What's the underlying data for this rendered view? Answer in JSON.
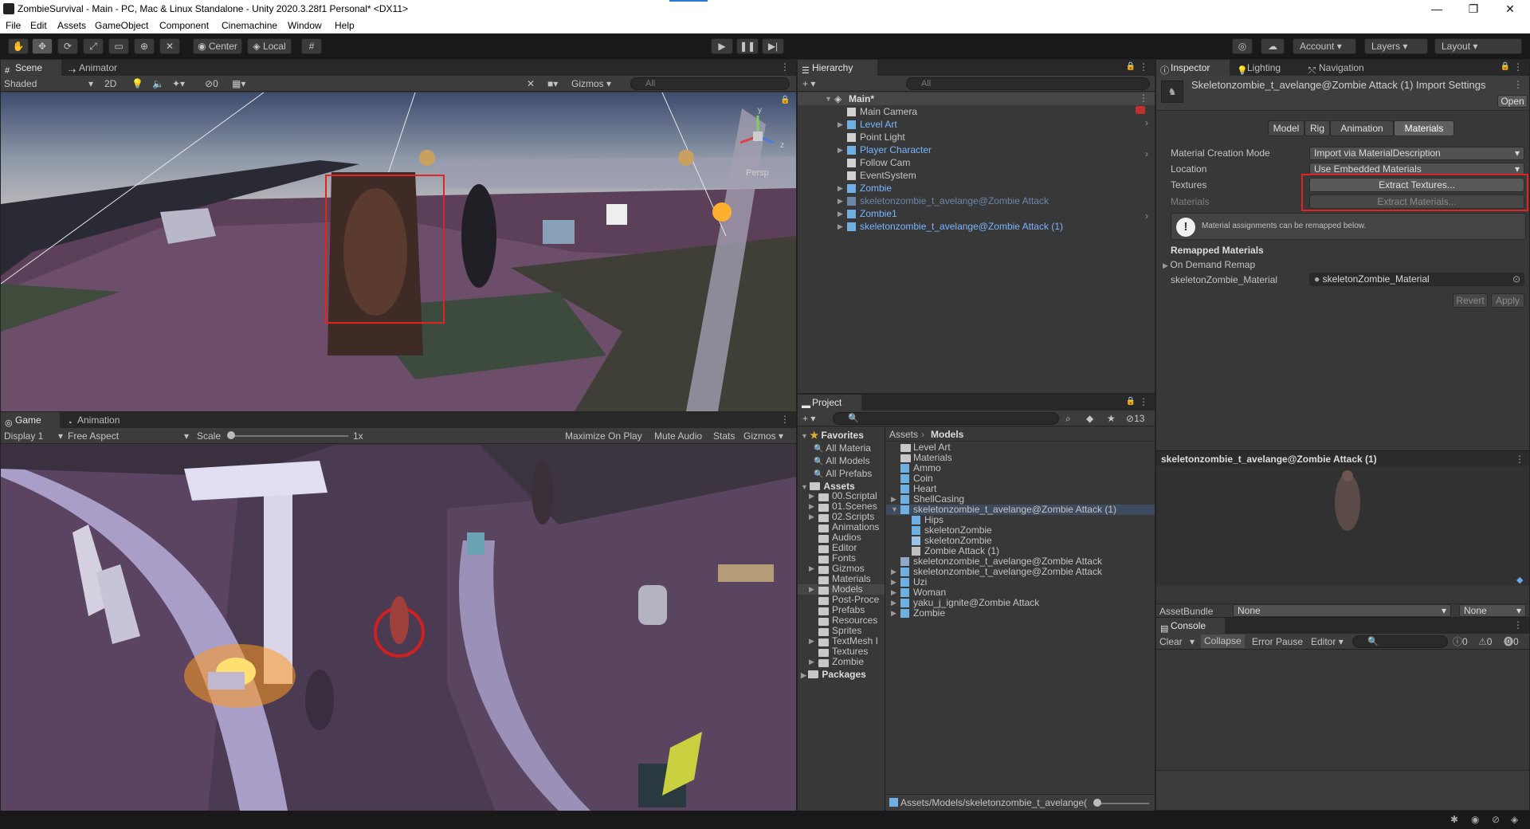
{
  "window": {
    "title": "ZombieSurvival - Main - PC, Mac & Linux Standalone - Unity 2020.3.28f1 Personal* <DX11>",
    "minimize": "—",
    "maximize": "❐",
    "close": "✕"
  },
  "menu": [
    "File",
    "Edit",
    "Assets",
    "GameObject",
    "Component",
    "Cinemachine",
    "Window",
    "Help"
  ],
  "toolbar": {
    "center": "Center",
    "local": "Local",
    "account": "Account",
    "layers": "Layers",
    "layout": "Layout"
  },
  "scene": {
    "tabs": [
      "Scene",
      "Animator"
    ],
    "shading": "Shaded",
    "mode2d": "2D",
    "hidden_count": "0",
    "gizmos": "Gizmos",
    "search_placeholder": "All",
    "persp_label": "Persp"
  },
  "game": {
    "tabs": [
      "Game",
      "Animation"
    ],
    "display": "Display 1",
    "aspect": "Free Aspect",
    "scale_label": "Scale",
    "scale_value": "1x",
    "maximize": "Maximize On Play",
    "mute": "Mute Audio",
    "stats": "Stats",
    "gizmos": "Gizmos"
  },
  "hierarchy": {
    "tab": "Hierarchy",
    "search_placeholder": "All",
    "scene_name": "Main*",
    "items": [
      {
        "label": "Main Camera",
        "style": "normal",
        "expand": false
      },
      {
        "label": "Level Art",
        "style": "blue",
        "expand": true
      },
      {
        "label": "Point Light",
        "style": "normal",
        "expand": false
      },
      {
        "label": "Player Character",
        "style": "blue",
        "expand": true
      },
      {
        "label": "Follow Cam",
        "style": "normal",
        "expand": false
      },
      {
        "label": "EventSystem",
        "style": "normal",
        "expand": false
      },
      {
        "label": "Zombie",
        "style": "blue",
        "expand": true
      },
      {
        "label": "skeletonzombie_t_avelange@Zombie Attack",
        "style": "dim",
        "expand": true
      },
      {
        "label": "Zombie1",
        "style": "blue",
        "expand": true
      },
      {
        "label": "skeletonzombie_t_avelange@Zombie Attack (1)",
        "style": "blue",
        "expand": true
      }
    ]
  },
  "project": {
    "tab": "Project",
    "count": "13",
    "favorites_label": "Favorites",
    "favorites": [
      "All Materia",
      "All Models",
      "All Prefabs"
    ],
    "assets_label": "Assets",
    "folders": [
      "00.Scriptal",
      "01.Scenes",
      "02.Scripts",
      "Animations",
      "Audios",
      "Editor",
      "Fonts",
      "Gizmos",
      "Materials",
      "Models",
      "Post-Proce",
      "Prefabs",
      "Resources",
      "Sprites",
      "TextMesh I",
      "Textures",
      "Zombie"
    ],
    "packages_label": "Packages",
    "breadcrumb_root": "Assets",
    "breadcrumb_current": "Models",
    "files": [
      {
        "label": "Level Art",
        "kind": "folder",
        "indent": 0
      },
      {
        "label": "Materials",
        "kind": "folder",
        "indent": 0
      },
      {
        "label": "Ammo",
        "kind": "model",
        "indent": 0
      },
      {
        "label": "Coin",
        "kind": "model",
        "indent": 0
      },
      {
        "label": "Heart",
        "kind": "model",
        "indent": 0
      },
      {
        "label": "ShellCasing",
        "kind": "model",
        "indent": 0
      },
      {
        "label": "skeletonzombie_t_avelange@Zombie Attack (1)",
        "kind": "model",
        "indent": 0,
        "selected": true
      },
      {
        "label": "Hips",
        "kind": "model",
        "indent": 1
      },
      {
        "label": "skeletonZombie",
        "kind": "model",
        "indent": 1
      },
      {
        "label": "skeletonZombie",
        "kind": "mesh",
        "indent": 1
      },
      {
        "label": "Zombie Attack (1)",
        "kind": "anim",
        "indent": 1
      },
      {
        "label": "skeletonzombie_t_avelange@Zombie Attack",
        "kind": "prefab",
        "indent": 0
      },
      {
        "label": "skeletonzombie_t_avelange@Zombie Attack",
        "kind": "model",
        "indent": 0
      },
      {
        "label": "Uzi",
        "kind": "model",
        "indent": 0
      },
      {
        "label": "Woman",
        "kind": "model",
        "indent": 0
      },
      {
        "label": "yaku_j_ignite@Zombie Attack",
        "kind": "model",
        "indent": 0
      },
      {
        "label": "Zombie",
        "kind": "model",
        "indent": 0
      }
    ],
    "path": "Assets/Models/skeletonzombie_t_avelange("
  },
  "inspector": {
    "tabs": [
      "Inspector",
      "Lighting",
      "Navigation"
    ],
    "title": "Skeletonzombie_t_avelange@Zombie Attack (1) Import Settings",
    "open": "Open",
    "subtabs": [
      "Model",
      "Rig",
      "Animation",
      "Materials"
    ],
    "material_creation_mode_label": "Material Creation Mode",
    "material_creation_mode_value": "Import via MaterialDescription",
    "location_label": "Location",
    "location_value": "Use Embedded Materials",
    "textures_label": "Textures",
    "extract_textures": "Extract Textures...",
    "materials_label": "Materials",
    "extract_materials": "Extract Materials...",
    "info": "Material assignments can be remapped below.",
    "remapped_header": "Remapped Materials",
    "on_demand": "On Demand Remap",
    "material_slot_label": "skeletonZombie_Material",
    "material_slot_value": "skeletonZombie_Material",
    "revert": "Revert",
    "apply": "Apply",
    "preview_title": "skeletonzombie_t_avelange@Zombie Attack (1)",
    "assetbundle_label": "AssetBundle",
    "assetbundle_value": "None",
    "assetbundle_variant": "None"
  },
  "console": {
    "tab": "Console",
    "clear": "Clear",
    "collapse": "Collapse",
    "error_pause": "Error Pause",
    "editor": "Editor",
    "info_count": "0",
    "warn_count": "0",
    "error_count": "0"
  },
  "colors": {
    "highlight": "#e02424",
    "link_blue": "#7bb5ff",
    "panel": "#383838"
  }
}
